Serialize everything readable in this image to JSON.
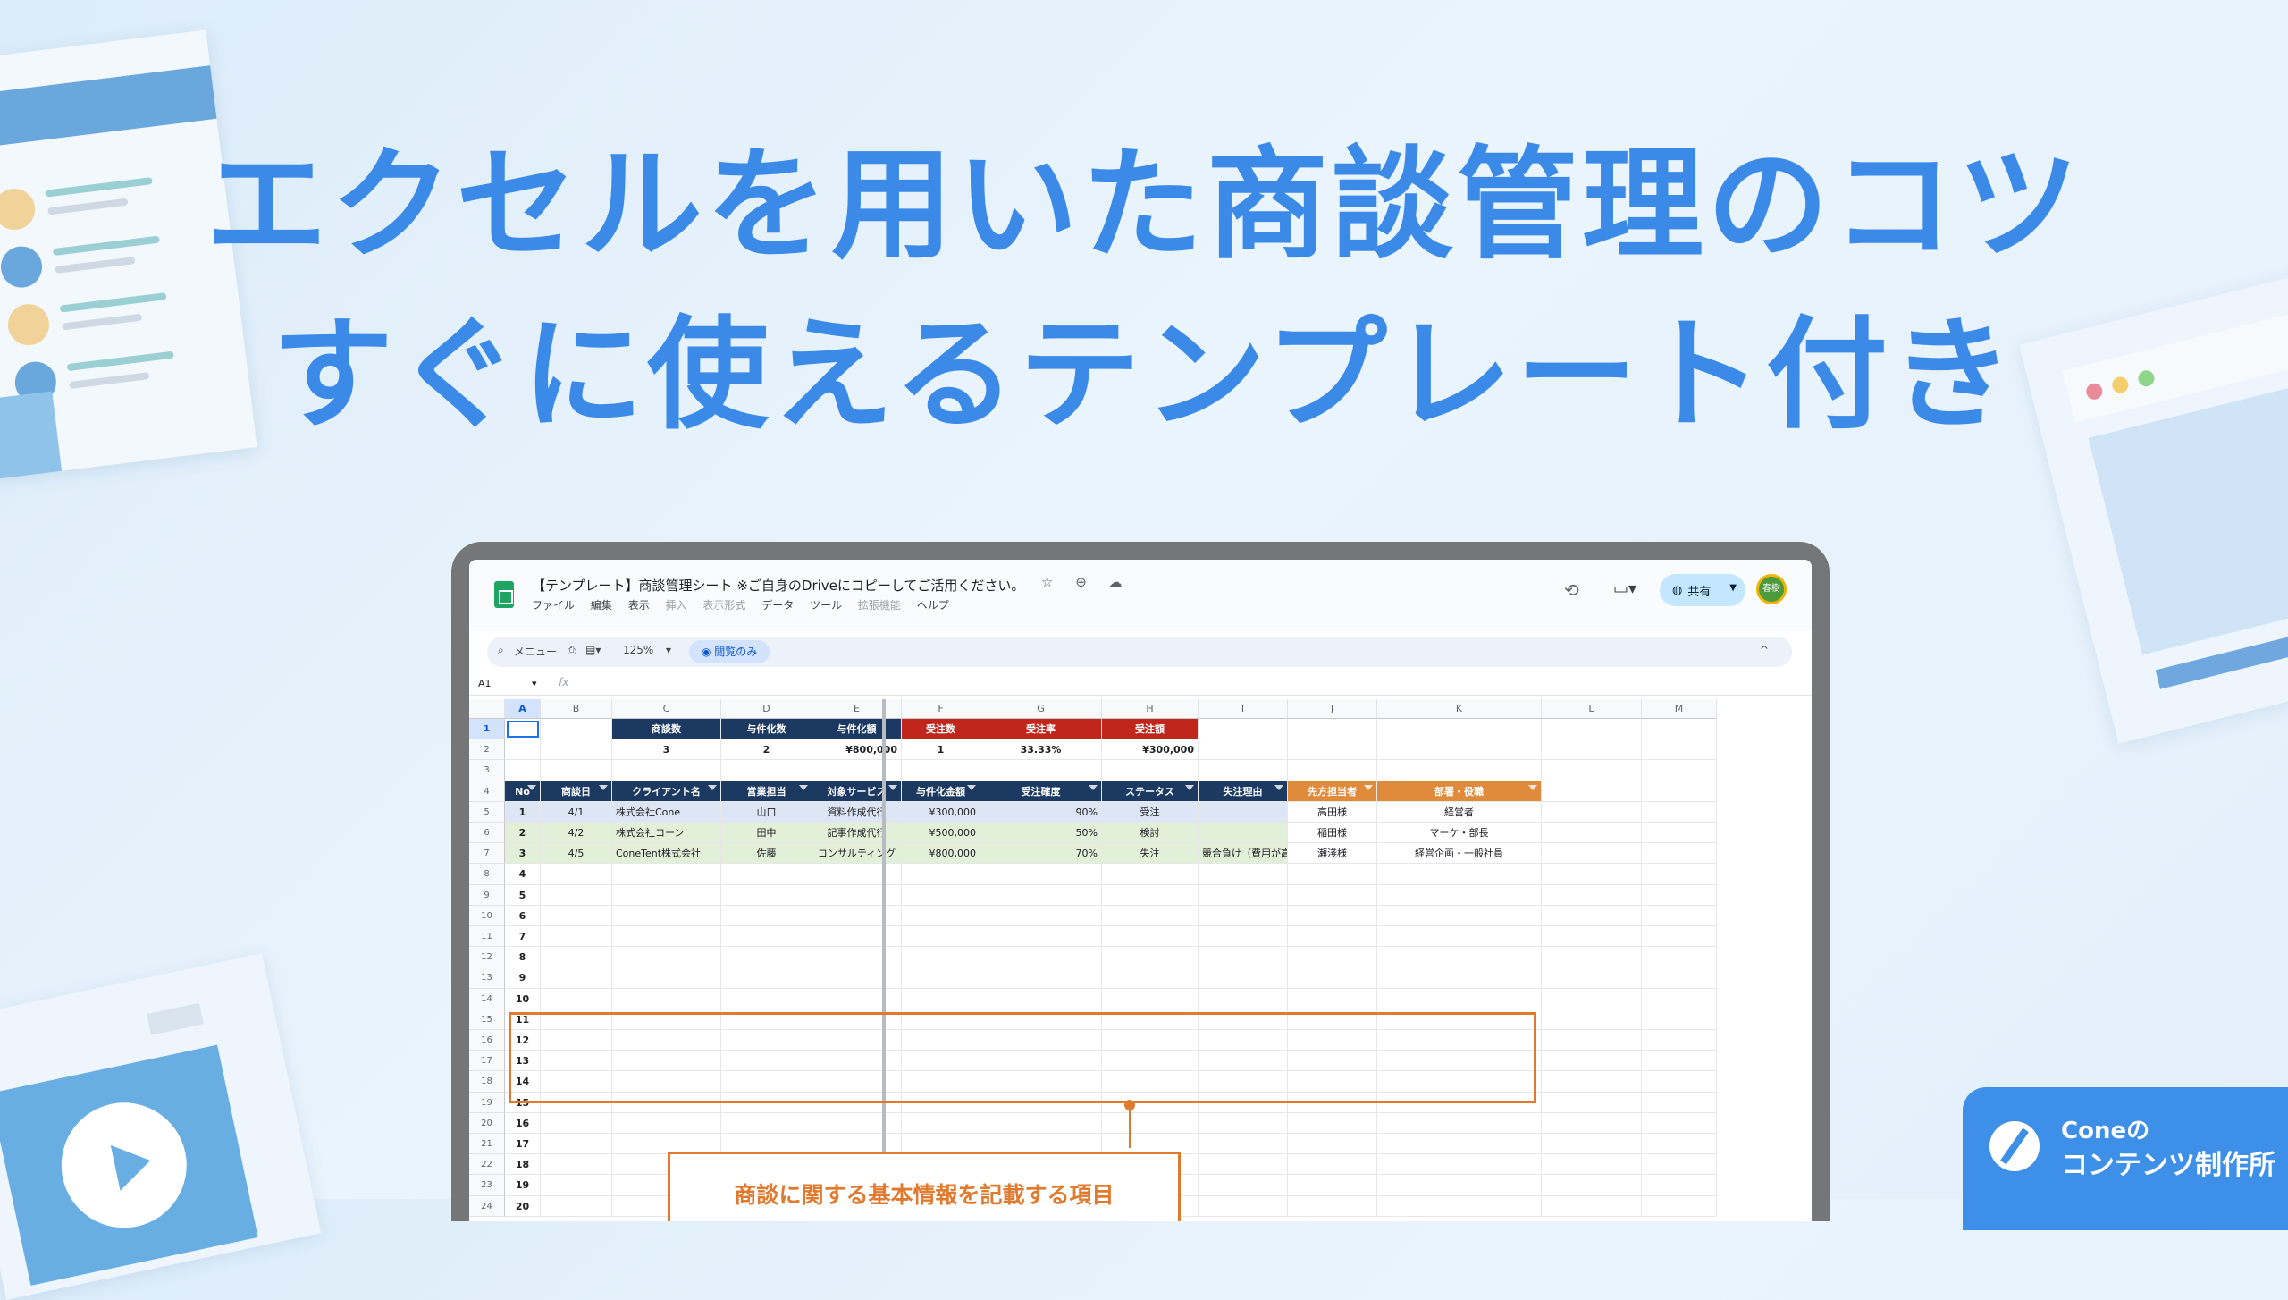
{
  "headline": {
    "line1": "エクセルを用いた商談管理のコツ",
    "line2": "すぐに使えるテンプレート付き"
  },
  "sheet": {
    "title": "【テンプレート】商談管理シート ※ご自身のDriveにコピーしてご活用ください。",
    "title_icons": "☆ ⊕ ☁",
    "menu": [
      "ファイル",
      "編集",
      "表示",
      "挿入",
      "表示形式",
      "データ",
      "ツール",
      "拡張機能",
      "ヘルプ"
    ],
    "share_label": "共有",
    "avatar_label": "春樹",
    "toolbar": {
      "search": "メニュー",
      "zoom": "125%",
      "view_only": "閲覧のみ",
      "collapse": "^"
    },
    "cell_ref": "A1",
    "fx": "fx",
    "columns": [
      "A",
      "B",
      "C",
      "D",
      "E",
      "F",
      "G",
      "H",
      "I",
      "J",
      "K",
      "L",
      "M"
    ],
    "row_numbers": [
      "1",
      "2",
      "3",
      "4",
      "5",
      "6",
      "7",
      "8",
      "9",
      "10",
      "11",
      "12",
      "13",
      "14",
      "15",
      "16",
      "17",
      "18",
      "19",
      "20",
      "21",
      "22",
      "23",
      "24"
    ],
    "summary_headers": [
      "商談数",
      "与件化数",
      "与件化額",
      "受注数",
      "受注率",
      "受注額"
    ],
    "summary_values": [
      "3",
      "2",
      "¥800,000",
      "1",
      "33.33%",
      "¥300,000"
    ],
    "table_headers": [
      "No",
      "商談日",
      "クライアント名",
      "営業担当",
      "対象サービス",
      "与件化金額",
      "受注確度",
      "ステータス",
      "失注理由",
      "先方担当者",
      "部署・役職"
    ],
    "rows": [
      [
        "1",
        "4/1",
        "株式会社Cone",
        "山口",
        "資料作成代行",
        "¥300,000",
        "90%",
        "受注",
        "",
        "高田様",
        "経営者"
      ],
      [
        "2",
        "4/2",
        "株式会社コーン",
        "田中",
        "記事作成代行",
        "¥500,000",
        "50%",
        "検討",
        "",
        "稲田様",
        "マーケ・部長"
      ],
      [
        "3",
        "4/5",
        "ConeTent株式会社",
        "佐藤",
        "コンサルティング",
        "¥800,000",
        "70%",
        "失注",
        "競合負け（費用が高い）",
        "瀬淺様",
        "経営企画・一般社員"
      ]
    ],
    "empty_row_numbers": [
      "4",
      "5",
      "6",
      "7",
      "8",
      "9",
      "10",
      "11",
      "12",
      "13",
      "14",
      "15",
      "16",
      "17",
      "18",
      "19",
      "20"
    ]
  },
  "callout": "商談に関する基本情報を記載する項目",
  "badge": {
    "line1": "Coneの",
    "line2": "コンテンツ制作所"
  },
  "colors": {
    "headline": "#3b8ae8",
    "navy": "#1c3a61",
    "red": "#c0261c",
    "orange": "#e07a2e",
    "badge": "#3d8fe8"
  }
}
